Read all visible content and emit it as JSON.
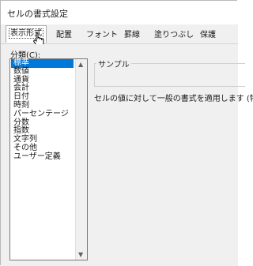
{
  "window": {
    "title": "セルの書式設定"
  },
  "tabs": [
    {
      "label": "表示形式",
      "active": true
    },
    {
      "label": "配置"
    },
    {
      "label": "フォント"
    },
    {
      "label": "罫線"
    },
    {
      "label": "塗りつぶし"
    },
    {
      "label": "保護"
    }
  ],
  "category": {
    "label": "分類(C):",
    "items": [
      "標準",
      "数値",
      "通貨",
      "会計",
      "日付",
      "時刻",
      "パーセンテージ",
      "分数",
      "指数",
      "文字列",
      "その他",
      "ユーザー定義"
    ],
    "selected_index": 0
  },
  "sample": {
    "label": "サンプル"
  },
  "description": "セルの値に対して一般の書式を適用します (特定",
  "colors": {
    "selection": "#0078d7",
    "dialog_bg": "#f0f0f0"
  }
}
